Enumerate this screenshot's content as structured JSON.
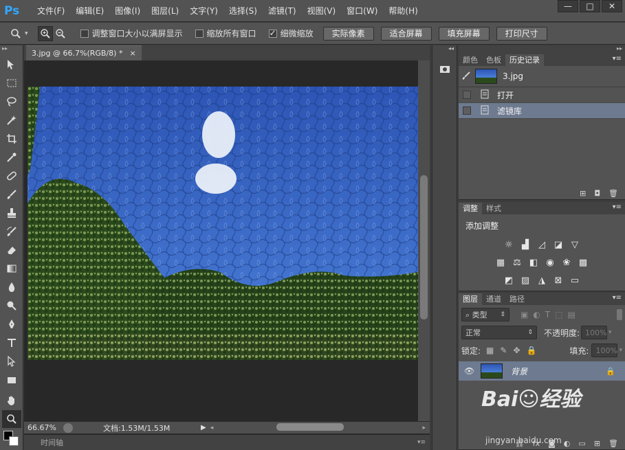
{
  "app": {
    "logo": "Ps"
  },
  "menubar": {
    "items": [
      "文件(F)",
      "编辑(E)",
      "图像(I)",
      "图层(L)",
      "文字(Y)",
      "选择(S)",
      "滤镜(T)",
      "视图(V)",
      "窗口(W)",
      "帮助(H)"
    ],
    "window_controls": [
      "—",
      "□",
      "✕"
    ]
  },
  "options": {
    "checks": [
      {
        "label": "调整窗口大小以满屏显示",
        "checked": false
      },
      {
        "label": "缩放所有窗口",
        "checked": false
      },
      {
        "label": "细微缩放",
        "checked": true
      }
    ],
    "buttons": [
      "实际像素",
      "适合屏幕",
      "填充屏幕",
      "打印尺寸"
    ]
  },
  "document": {
    "tab_title": "3.jpg @ 66.7%(RGB/8) *",
    "tab_close": "×",
    "zoom": "66.67%",
    "doc_info": "文档:1.53M/1.53M",
    "timeline_label": "时间轴"
  },
  "history_panel": {
    "tabs": [
      "颜色",
      "色板",
      "历史记录"
    ],
    "active_tab": 2,
    "snapshot_name": "3.jpg",
    "steps": [
      {
        "label": "打开",
        "selected": false
      },
      {
        "label": "滤镜库",
        "selected": true
      }
    ]
  },
  "adjust_panel": {
    "tabs": [
      "调整",
      "样式"
    ],
    "active_tab": 0,
    "title": "添加调整"
  },
  "layers_panel": {
    "tabs": [
      "图层",
      "通道",
      "路径"
    ],
    "active_tab": 0,
    "filter_kind": "⌕ 类型",
    "blend_mode": "正常",
    "opacity_label": "不透明度:",
    "opacity_value": "100%",
    "lock_label": "锁定:",
    "fill_label": "填充:",
    "fill_value": "100%",
    "layers": [
      {
        "name": "背景",
        "visible": true,
        "locked": true,
        "selected": true
      }
    ]
  },
  "watermark": {
    "brand": "Bai☺经验",
    "url": "jingyan.baidu.com"
  },
  "colors": {
    "accent_selected_row": "#6d7a8f",
    "ui_base": "#535353",
    "ps_logo": "#31a8ff"
  }
}
